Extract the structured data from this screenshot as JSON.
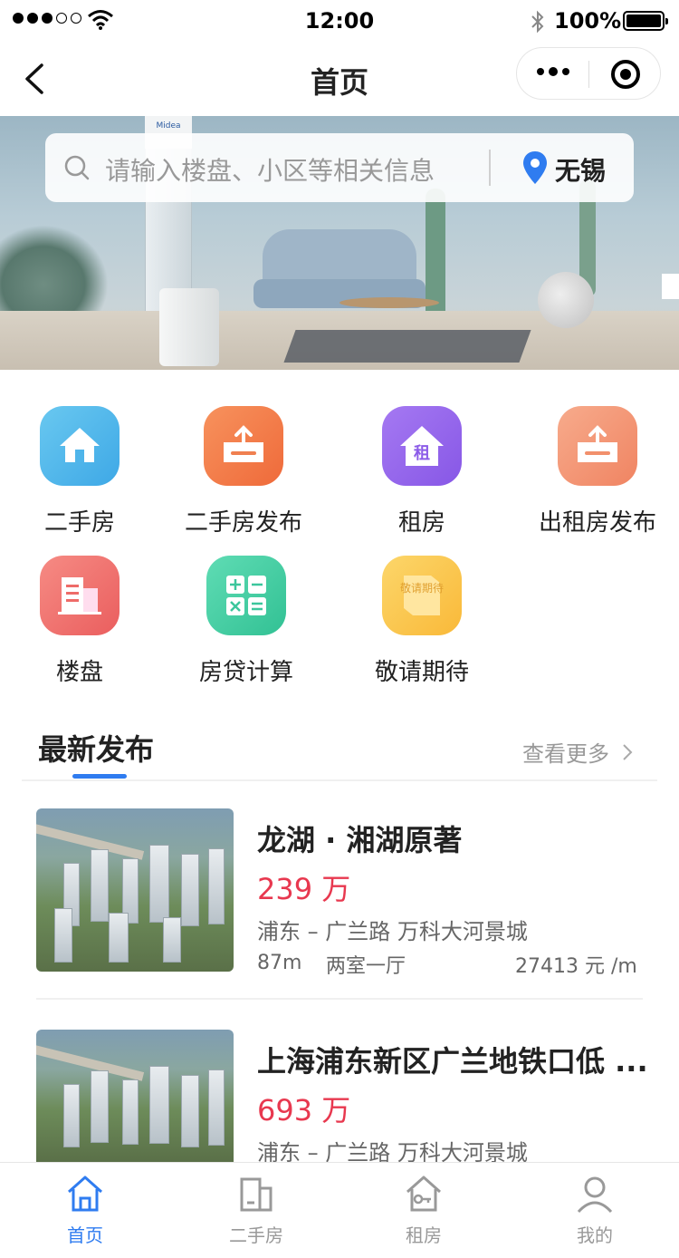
{
  "status_bar": {
    "time": "12:00",
    "battery": "100%"
  },
  "nav": {
    "title": "首页"
  },
  "search": {
    "placeholder": "请输入楼盘、小区等相关信息",
    "city": "无锡"
  },
  "menu": [
    {
      "label": "二手房",
      "icon": "house-icon",
      "color": "#3ea8e6"
    },
    {
      "label": "二手房发布",
      "icon": "upload-box-icon",
      "color": "#ef6a3a"
    },
    {
      "label": "租房",
      "icon": "rent-house-icon",
      "icon_text": "租",
      "color": "#8757e6"
    },
    {
      "label": "出租房发布",
      "icon": "upload-box-icon",
      "color": "#f08462"
    },
    {
      "label": "楼盘",
      "icon": "building-icon",
      "color": "#ea5e5e"
    },
    {
      "label": "房贷计算",
      "icon": "calculator-icon",
      "color": "#32c194"
    },
    {
      "label": "敬请期待",
      "icon": "coming-soon-icon",
      "icon_text": "敬请期待",
      "color": "#f9b939"
    }
  ],
  "latest": {
    "title": "最新发布",
    "more": "查看更多"
  },
  "listings": [
    {
      "title": "龙湖 · 湘湖原著",
      "price": "239 万",
      "location": "浦东 – 广兰路   万科大河景城",
      "area": "87m",
      "rooms": "两室一厅",
      "unit_price": "27413 元 /m"
    },
    {
      "title": "上海浦东新区广兰地铁口低 ...",
      "price": "693 万",
      "location": "浦东 – 广兰路   万科大河景城"
    }
  ],
  "tabs": [
    {
      "label": "首页",
      "icon": "home-icon",
      "active": true
    },
    {
      "label": "二手房",
      "icon": "building-icon",
      "active": false
    },
    {
      "label": "租房",
      "icon": "key-house-icon",
      "active": false
    },
    {
      "label": "我的",
      "icon": "user-icon",
      "active": false
    }
  ],
  "colors": {
    "accent": "#2f7cf0",
    "price": "#e8384f"
  }
}
